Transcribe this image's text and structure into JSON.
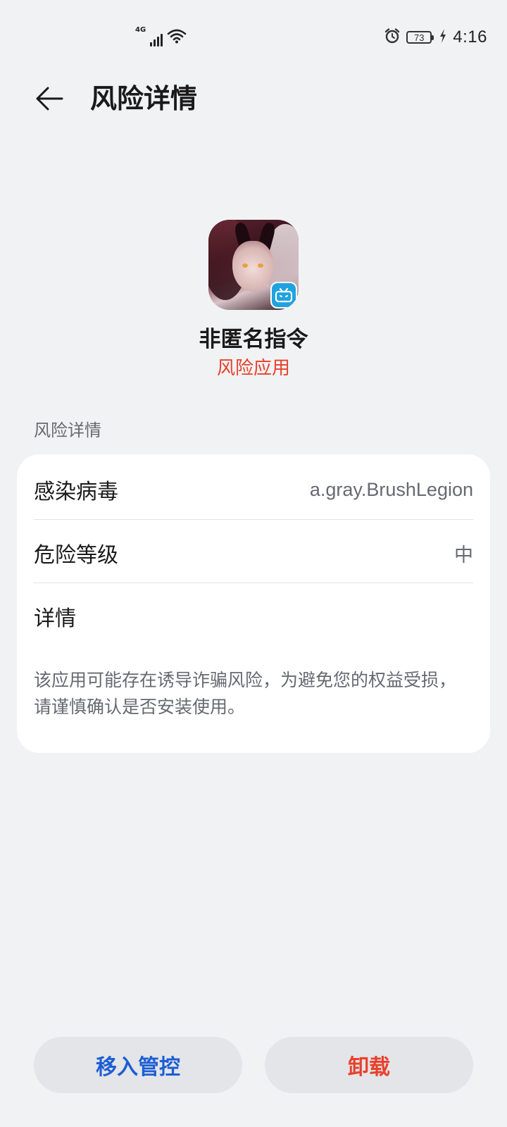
{
  "status_bar": {
    "network_type": "4G",
    "signal_icon": "cellular-signal-icon",
    "wifi_icon": "wifi-icon",
    "alarm_icon": "alarm-clock-icon",
    "battery_level": "73",
    "charging_icon": "charging-bolt-icon",
    "time": "4:16"
  },
  "header": {
    "back_icon": "arrow-left-icon",
    "title": "风险详情"
  },
  "app": {
    "name": "非匿名指令",
    "status": "风险应用",
    "status_color": "#e8412c",
    "badge_icon": "bilibili-tv-icon",
    "badge_color": "#1fa3e0"
  },
  "section": {
    "label": "风险详情"
  },
  "details": {
    "virus_label": "感染病毒",
    "virus_value": "a.gray.BrushLegion",
    "level_label": "危险等级",
    "level_value": "中",
    "info_label": "详情",
    "info_text": "该应用可能存在诱导诈骗风险，为避免您的权益受损，请谨慎确认是否安装使用。"
  },
  "actions": {
    "move_label": "移入管控",
    "move_color": "#1c5fd4",
    "uninstall_label": "卸载",
    "uninstall_color": "#e8412c"
  }
}
